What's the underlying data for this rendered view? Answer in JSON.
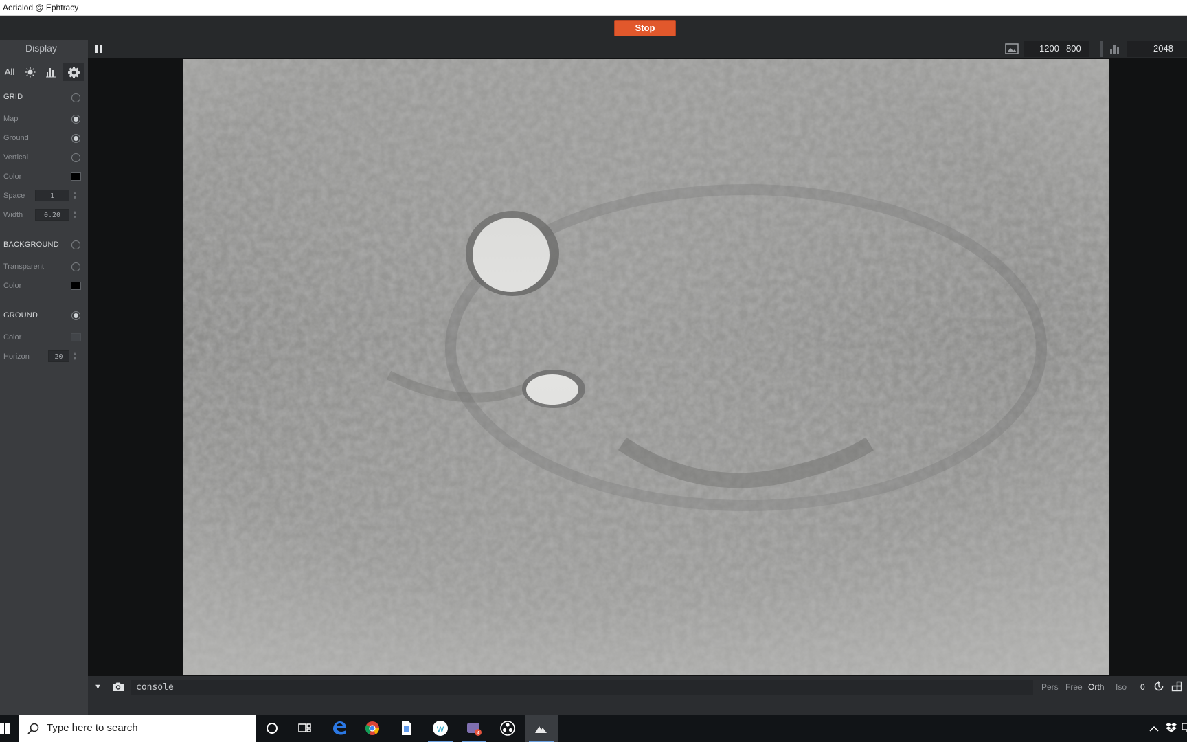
{
  "window": {
    "title": "Aerialod @ Ephtracy"
  },
  "toolbar": {
    "stop_label": "Stop"
  },
  "sidebar": {
    "title": "Display",
    "tabs": {
      "all": "All"
    },
    "grid": {
      "header": "GRID",
      "map": "Map",
      "ground": "Ground",
      "vertical": "Vertical",
      "color": "Color",
      "space_label": "Space",
      "space_value": "1",
      "width_label": "Width",
      "width_value": "0.20"
    },
    "background": {
      "header": "BACKGROUND",
      "transparent": "Transparent",
      "color": "Color"
    },
    "ground": {
      "header": "GROUND",
      "color": "Color",
      "horizon_label": "Horizon",
      "horizon_value": "20"
    }
  },
  "viewbar": {
    "width": "1200",
    "height": "800",
    "samples": "2048"
  },
  "console": {
    "placeholder": "console",
    "modes": {
      "pers": "Pers",
      "free": "Free",
      "orth": "Orth",
      "iso": "Iso"
    },
    "angle": "0"
  },
  "taskbar": {
    "search_placeholder": "Type here to search"
  },
  "colors": {
    "accent_stop": "#e1582c",
    "progress": "#5a8fd1",
    "toggle_on": "#cfd3d6"
  },
  "render": {
    "progress_fraction": 0.27
  }
}
